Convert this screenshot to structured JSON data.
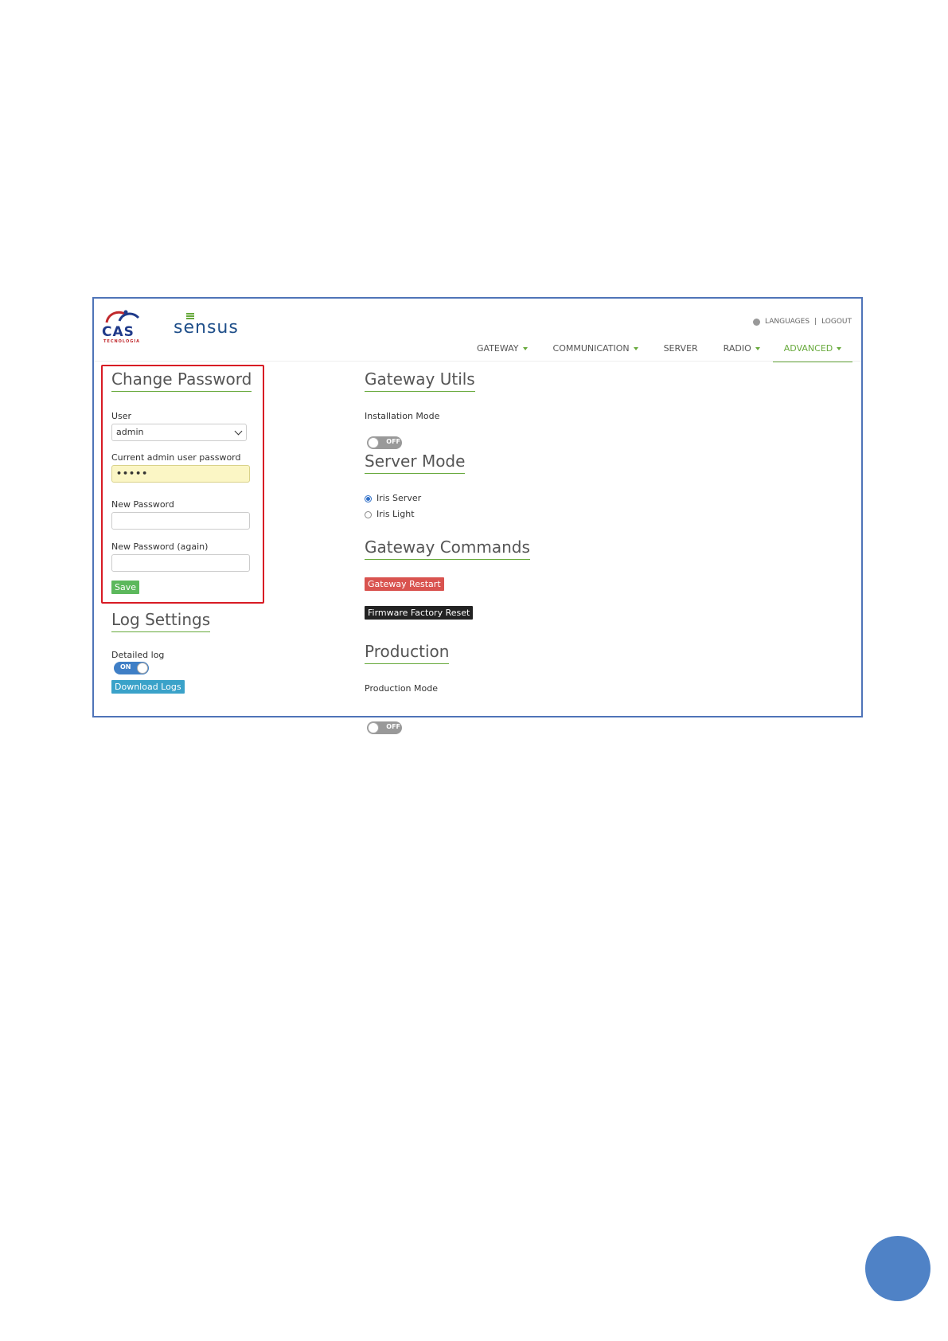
{
  "header": {
    "cas_logo": {
      "text": "CAS",
      "subtext": "TECNOLOGIA"
    },
    "sensus_logo": {
      "text": "sensus"
    },
    "top_links": {
      "languages": "LANGUAGES",
      "separator": "|",
      "logout": "LOGOUT"
    }
  },
  "nav": {
    "items": [
      {
        "label": "GATEWAY"
      },
      {
        "label": "COMMUNICATION"
      },
      {
        "label": "SERVER"
      },
      {
        "label": "RADIO"
      },
      {
        "label": "ADVANCED"
      }
    ]
  },
  "change_password": {
    "title": "Change Password",
    "user_label": "User",
    "user_value": "admin",
    "current_label": "Current admin user password",
    "current_value": "•••••",
    "new_label": "New Password",
    "new_value": "",
    "again_label": "New Password (again)",
    "again_value": "",
    "save_label": "Save"
  },
  "log_settings": {
    "title": "Log Settings",
    "detailed_label": "Detailed log",
    "detailed_state": "ON",
    "download_label": "Download Logs"
  },
  "gateway_utils": {
    "title": "Gateway Utils",
    "installation_label": "Installation Mode",
    "installation_state": "OFF"
  },
  "server_mode": {
    "title": "Server Mode",
    "options": [
      {
        "label": "Iris Server",
        "checked": true
      },
      {
        "label": "Iris Light",
        "checked": false
      }
    ]
  },
  "gateway_commands": {
    "title": "Gateway Commands",
    "restart_label": "Gateway Restart",
    "factory_reset_label": "Firmware Factory Reset"
  },
  "production": {
    "title": "Production",
    "mode_label": "Production Mode",
    "mode_state": "OFF"
  },
  "colors": {
    "accent_green": "#67a93b",
    "highlight_red": "#d81b24",
    "frame_blue": "#4f74b8",
    "page_dot": "#4f82c6"
  }
}
